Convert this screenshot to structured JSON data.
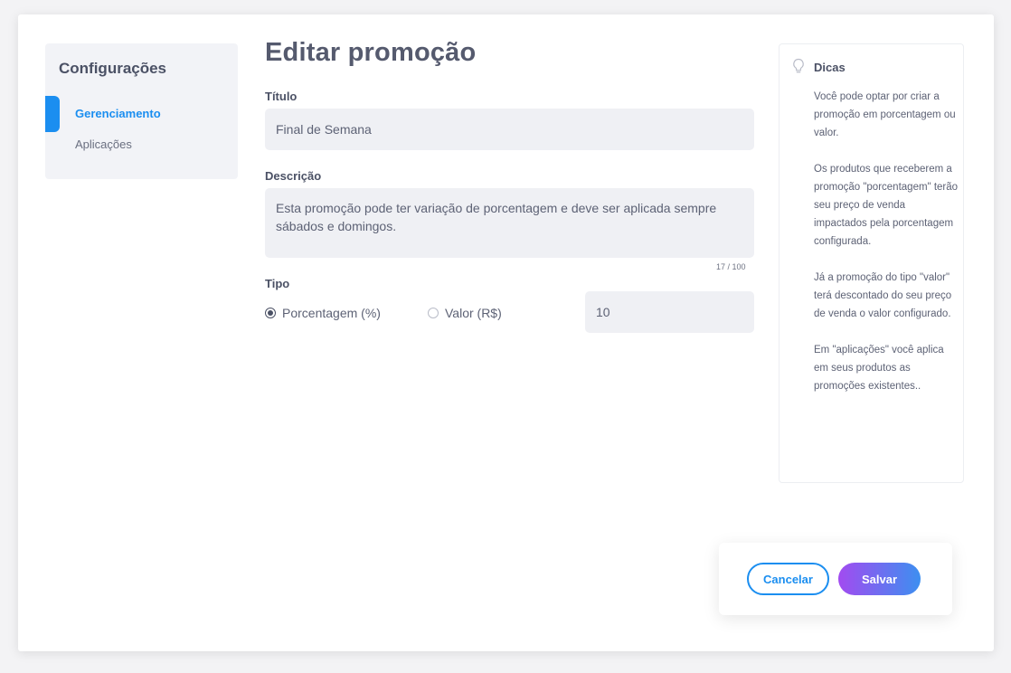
{
  "sidebar": {
    "title": "Configurações",
    "items": [
      {
        "label": "Gerenciamento",
        "active": true
      },
      {
        "label": "Aplicações",
        "active": false
      }
    ]
  },
  "main": {
    "page_title": "Editar promoção",
    "titulo_label": "Título",
    "titulo_value": "Final de Semana",
    "descricao_label": "Descrição",
    "descricao_value": "Esta promoção pode ter variação de porcentagem e deve ser aplicada sempre sábados e domingos.",
    "char_counter": "17 / 100",
    "tipo_label": "Tipo",
    "tipo_options": [
      {
        "label": "Porcentagem (%)",
        "selected": true
      },
      {
        "label": "Valor (R$)",
        "selected": false
      }
    ],
    "tipo_value": "10"
  },
  "tips": {
    "icon": "lightbulb-icon",
    "title": "Dicas",
    "paragraphs": [
      "Você pode optar por criar a promoção em porcentagem ou valor.",
      "Os produtos que receberem a promoção \"porcentagem\" terão seu preço de venda impactados pela porcentagem configurada.",
      "Já a promoção do tipo \"valor\" terá descontado do seu preço de venda o valor configurado.",
      "Em \"aplicações\" você aplica em seus produtos as promoções existentes.."
    ]
  },
  "actions": {
    "cancel_label": "Cancelar",
    "save_label": "Salvar"
  },
  "colors": {
    "accent": "#1b8ef0",
    "save_gradient_start": "#a24bf0",
    "save_gradient_end": "#3d8ff0"
  }
}
